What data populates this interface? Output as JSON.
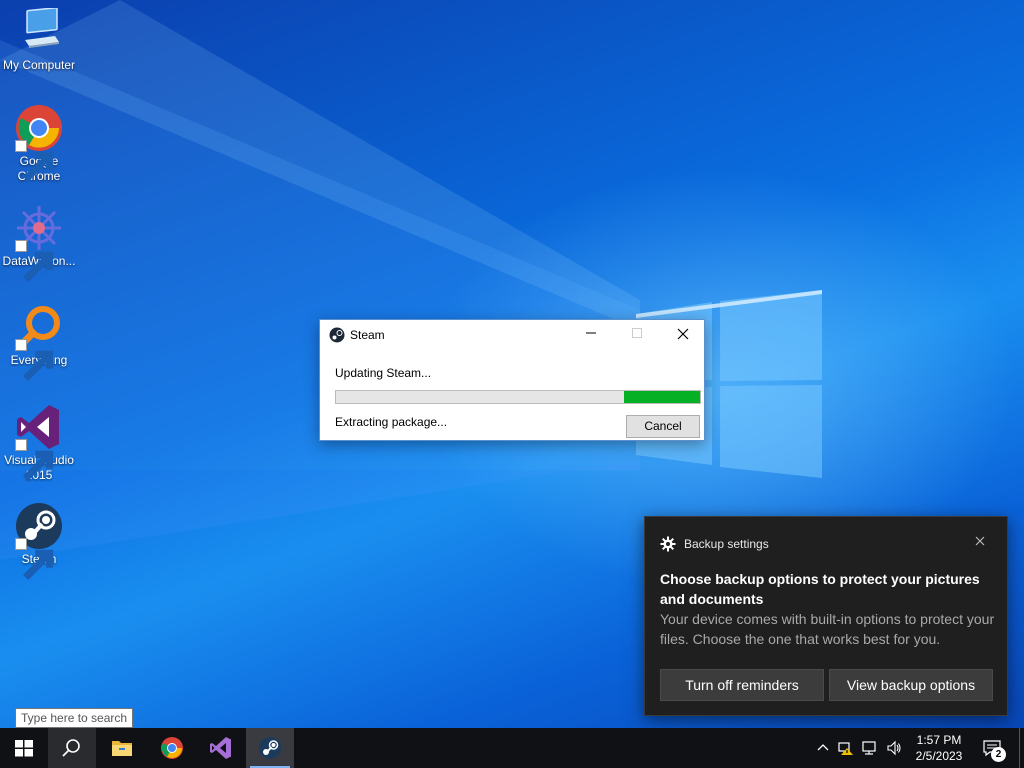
{
  "desktop": {
    "icons": [
      {
        "label": "My Computer",
        "icon": "computer-icon"
      },
      {
        "label": "Google Chrome",
        "icon": "chrome-icon"
      },
      {
        "label": "DataWagon...",
        "icon": "datawagon-icon"
      },
      {
        "label": "Everything",
        "icon": "everything-search-icon"
      },
      {
        "label": "Visual Studio 2015",
        "icon": "visual-studio-icon"
      },
      {
        "label": "Steam",
        "icon": "steam-icon"
      }
    ]
  },
  "steam_window": {
    "title": "Steam",
    "status": "Updating Steam...",
    "progress_fraction": 0.21,
    "progress_color": "#06b025",
    "detail": "Extracting package...",
    "cancel_label": "Cancel"
  },
  "notification": {
    "app_name": "Backup settings",
    "headline": "Choose backup options to protect your pictures and documents",
    "body": "Your device comes with built-in options to protect your files. Choose the one that works best for you.",
    "button_primary": "Turn off reminders",
    "button_secondary": "View backup options"
  },
  "search": {
    "tooltip": "Type here to search"
  },
  "taskbar": {
    "pinned": [
      "start-icon",
      "search-icon",
      "file-explorer-icon",
      "chrome-icon",
      "visual-studio-icon",
      "steam-icon"
    ],
    "clock_time": "1:57 PM",
    "clock_date": "2/5/2023",
    "notification_count": "2"
  },
  "colors": {
    "accent": "#0a62d8",
    "taskbar": "#101114",
    "toast_bg": "#1f1f1f"
  }
}
